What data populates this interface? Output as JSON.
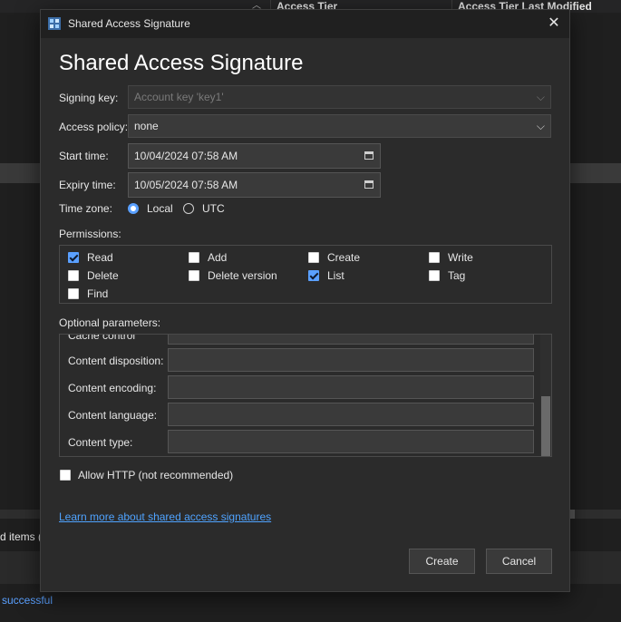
{
  "background": {
    "columns": [
      "Access Tier",
      "Access Tier Last Modified"
    ],
    "items_text": "d items (",
    "status_text": "successful"
  },
  "dialog": {
    "window_title": "Shared Access Signature",
    "heading": "Shared Access Signature",
    "close_symbol": "✕",
    "signing_key": {
      "label": "Signing key:",
      "value": "Account key 'key1'"
    },
    "access_policy": {
      "label": "Access policy:",
      "value": "none"
    },
    "start_time": {
      "label": "Start time:",
      "value": "10/04/2024 07:58  AM"
    },
    "expiry_time": {
      "label": "Expiry time:",
      "value": "10/05/2024 07:58  AM"
    },
    "time_zone": {
      "label": "Time zone:",
      "options": [
        "Local",
        "UTC"
      ],
      "selected": "Local"
    },
    "permissions": {
      "label": "Permissions:",
      "items": [
        {
          "label": "Read",
          "checked": true
        },
        {
          "label": "Add",
          "checked": false
        },
        {
          "label": "Create",
          "checked": false
        },
        {
          "label": "Write",
          "checked": false
        },
        {
          "label": "Delete",
          "checked": false
        },
        {
          "label": "Delete version",
          "checked": false
        },
        {
          "label": "List",
          "checked": true
        },
        {
          "label": "Tag",
          "checked": false
        },
        {
          "label": "Find",
          "checked": false
        }
      ]
    },
    "optional_parameters": {
      "label": "Optional parameters:",
      "fields": [
        {
          "label": "Cache control",
          "value": ""
        },
        {
          "label": "Content disposition:",
          "value": ""
        },
        {
          "label": "Content encoding:",
          "value": ""
        },
        {
          "label": "Content language:",
          "value": ""
        },
        {
          "label": "Content type:",
          "value": ""
        }
      ]
    },
    "allow_http": {
      "label": "Allow HTTP (not recommended)",
      "checked": false
    },
    "learn_more_link": "Learn more about shared access signatures",
    "create_button": "Create",
    "cancel_button": "Cancel"
  },
  "colors": {
    "accent": "#5aa0ff",
    "link": "#4fa3ff",
    "dialog_bg": "#2b2b2b",
    "titlebar_bg": "#202020"
  }
}
